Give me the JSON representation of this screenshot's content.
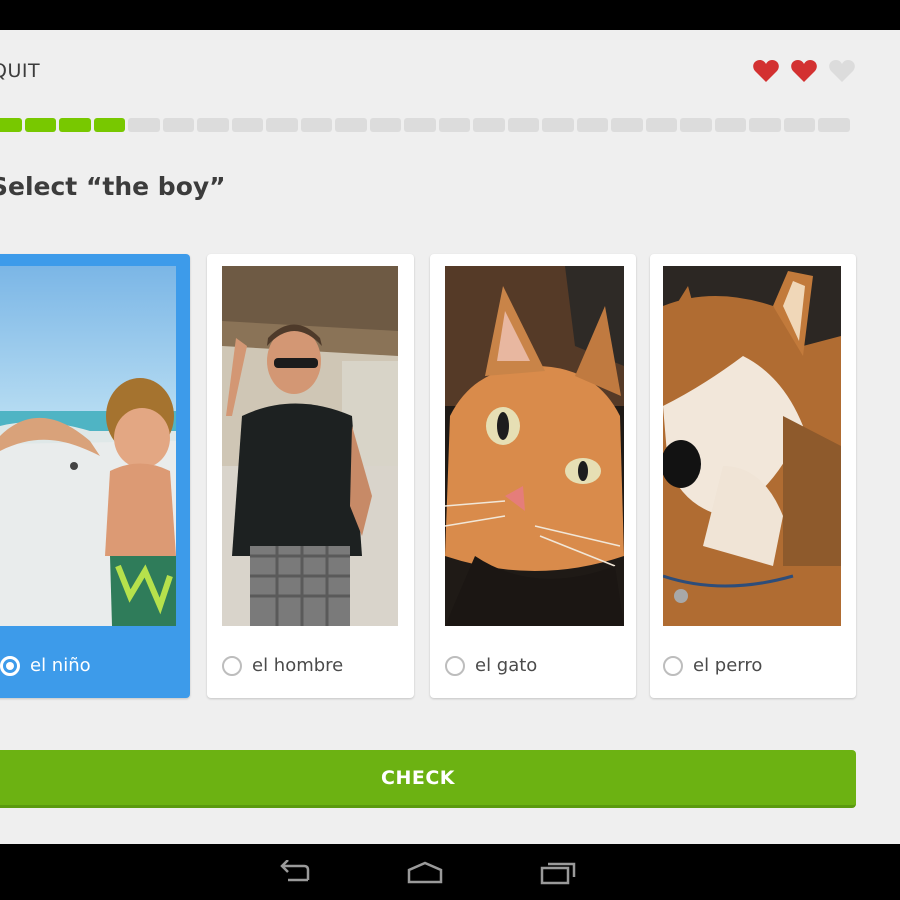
{
  "header": {
    "quit_label": "QUIT",
    "hearts": {
      "total": 3,
      "filled": 2,
      "filled_color": "#d33131",
      "empty_color": "#dcdcdc",
      "icon": "heart-icon"
    }
  },
  "progress": {
    "segments": 25,
    "completed": 4,
    "fraction": 0.16,
    "done_color": "#78c800",
    "todo_color": "#dcdcdc"
  },
  "prompt": {
    "text": "Select “the boy”"
  },
  "choices": [
    {
      "label": "el niño",
      "selected": true,
      "image": "boy-on-beach"
    },
    {
      "label": "el hombre",
      "selected": false,
      "image": "man-in-sunglasses"
    },
    {
      "label": "el gato",
      "selected": false,
      "image": "orange-cat"
    },
    {
      "label": "el perro",
      "selected": false,
      "image": "shiba-dog"
    }
  ],
  "check_button": {
    "label": "CHECK",
    "color": "#6cb212"
  },
  "system_nav": {
    "icons": [
      "back-icon",
      "home-icon",
      "recent-apps-icon"
    ]
  },
  "colors": {
    "selected_card": "#3d9bea",
    "background": "#efefef"
  }
}
